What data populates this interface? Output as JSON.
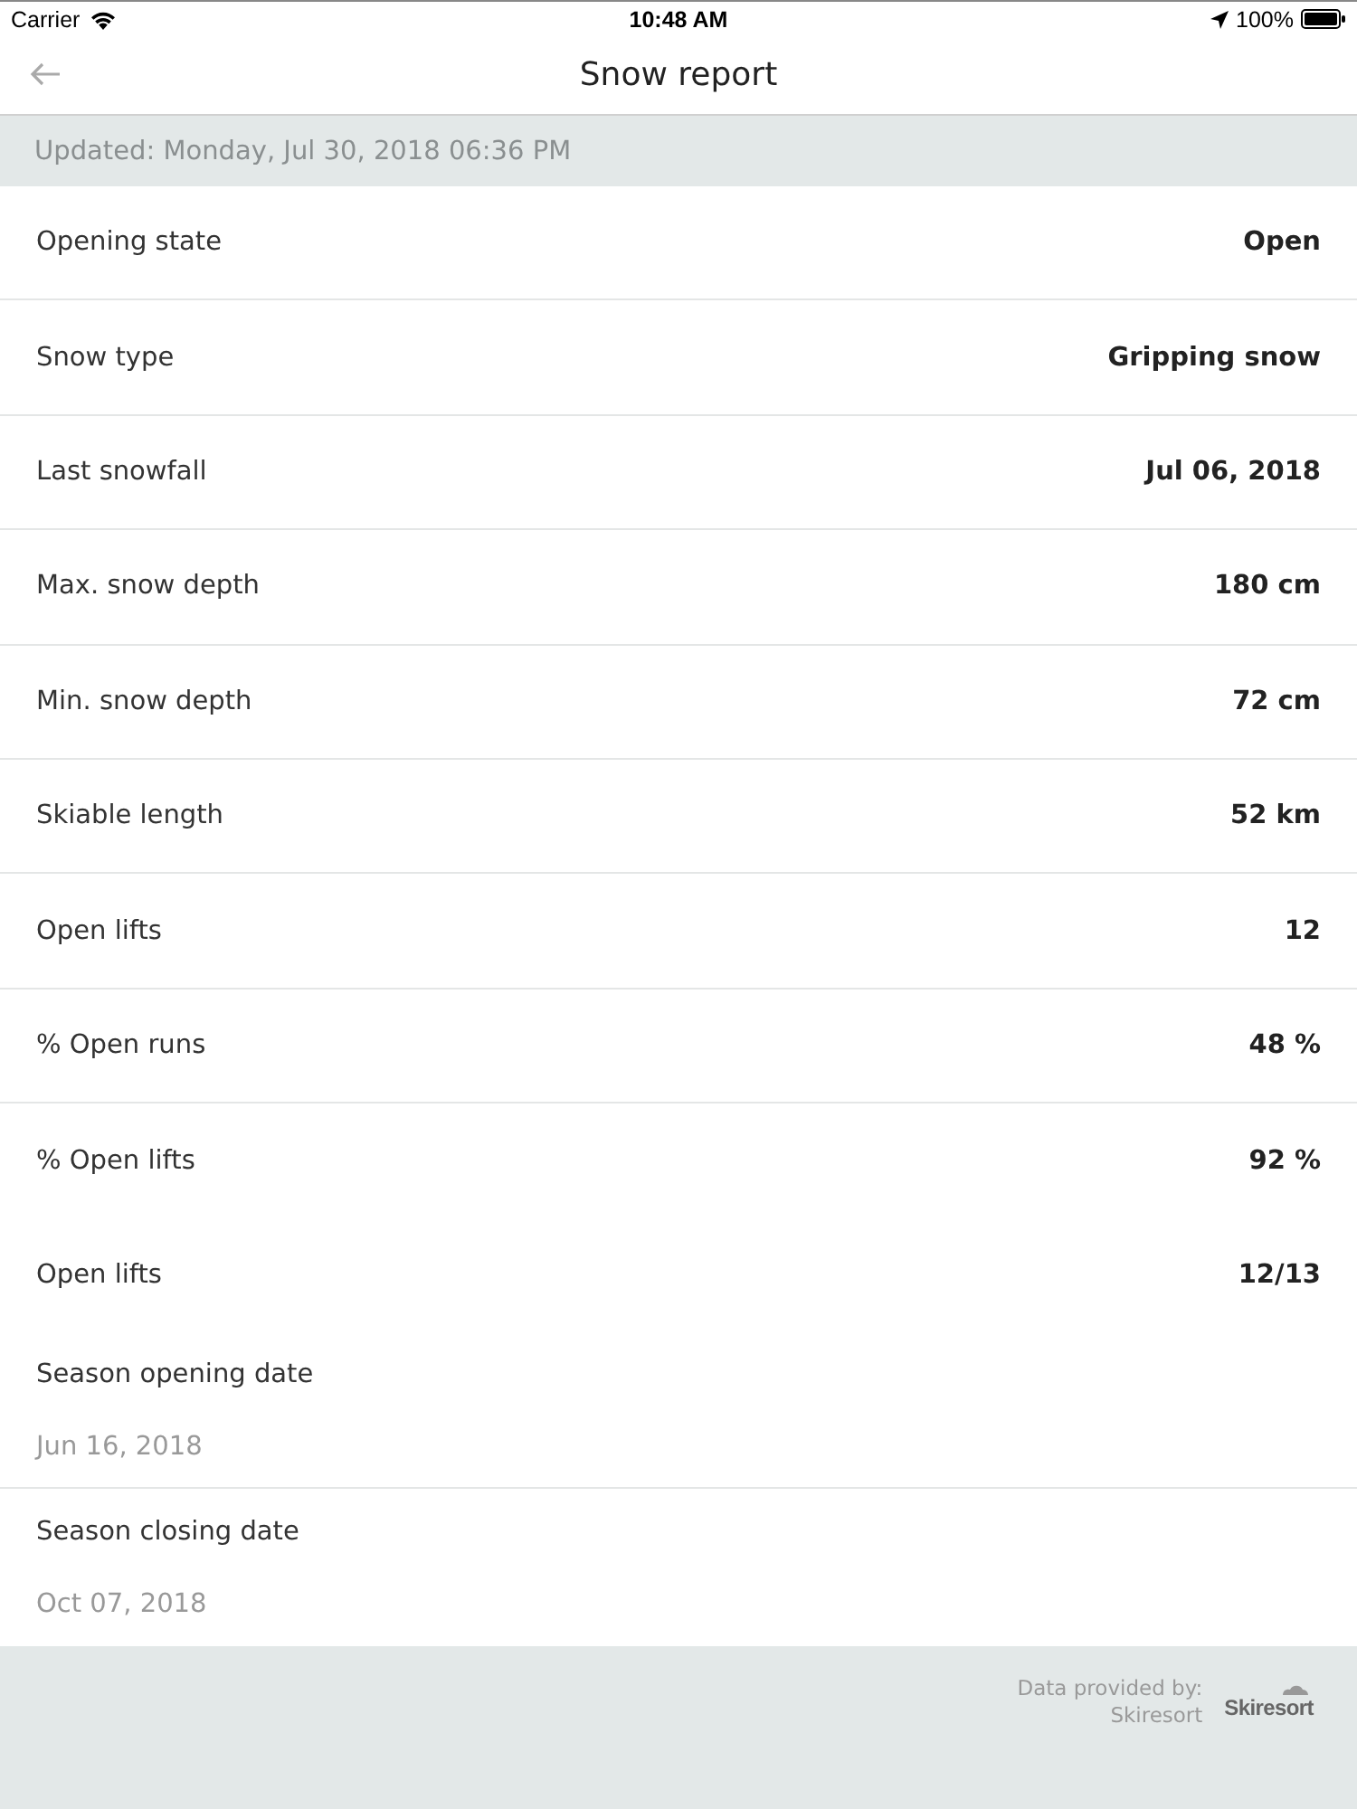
{
  "status_bar": {
    "carrier": "Carrier",
    "time": "10:48 AM",
    "battery": "100%"
  },
  "nav": {
    "title": "Snow report"
  },
  "updated": "Updated: Monday, Jul 30, 2018 06:36 PM",
  "rows": [
    {
      "kind": "pair",
      "label": "Opening state",
      "value": "Open",
      "divider": true
    },
    {
      "kind": "pair",
      "label": "Snow type",
      "value": "Gripping snow",
      "divider": true
    },
    {
      "kind": "pair",
      "label": "Last snowfall",
      "value": "Jul 06, 2018",
      "divider": true
    },
    {
      "kind": "pair",
      "label": "Max. snow depth",
      "value": "180 cm",
      "divider": true
    },
    {
      "kind": "pair",
      "label": "Min. snow depth",
      "value": "72 cm",
      "divider": true
    },
    {
      "kind": "pair",
      "label": "Skiable length",
      "value": "52 km",
      "divider": true
    },
    {
      "kind": "pair",
      "label": "Open lifts",
      "value": "12",
      "divider": true
    },
    {
      "kind": "pair",
      "label": "% Open runs",
      "value": "48 %",
      "divider": true
    },
    {
      "kind": "pair",
      "label": "% Open lifts",
      "value": "92 %",
      "divider": false
    },
    {
      "kind": "pair",
      "label": "Open lifts",
      "value": "12/13",
      "divider": false
    },
    {
      "kind": "stacked",
      "label": "Season opening date",
      "value": "Jun 16, 2018",
      "divider": true
    },
    {
      "kind": "stacked",
      "label": "Season closing date",
      "value": "Oct 07, 2018",
      "divider": false
    }
  ],
  "footer": {
    "credit_label": "Data provided by:",
    "credit_name": "Skiresort",
    "logo": "Skiresort"
  }
}
